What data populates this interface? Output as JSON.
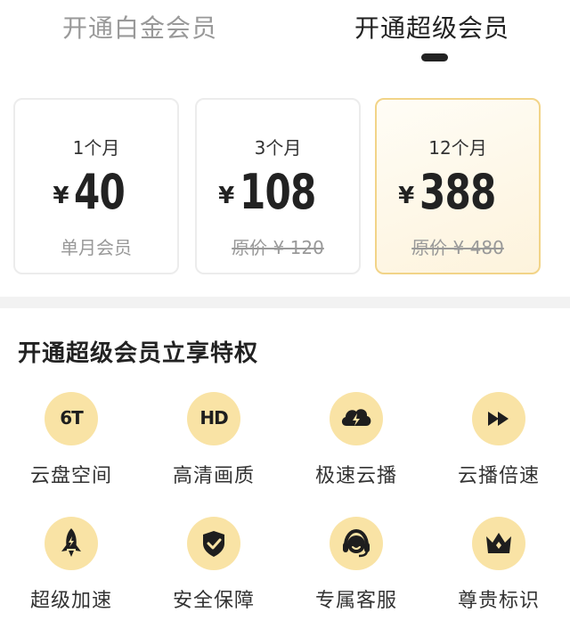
{
  "tabs": {
    "platinum": "开通白金会员",
    "super": "开通超级会员"
  },
  "plans": [
    {
      "duration": "1个月",
      "currency": "¥",
      "price": "40",
      "note": "单月会员"
    },
    {
      "duration": "3个月",
      "currency": "¥",
      "price": "108",
      "note": "原价 ¥ 120"
    },
    {
      "duration": "12个月",
      "currency": "¥",
      "price": "388",
      "note": "原价 ¥ 480"
    }
  ],
  "section": {
    "title": "开通超级会员立享特权"
  },
  "features": [
    {
      "label": "云盘空间",
      "badge": "6T",
      "icon": "storage-6t-icon"
    },
    {
      "label": "高清画质",
      "badge": "HD",
      "icon": "hd-icon"
    },
    {
      "label": "极速云播",
      "icon": "cloud-lightning-icon"
    },
    {
      "label": "云播倍速",
      "icon": "fast-forward-icon"
    },
    {
      "label": "超级加速",
      "icon": "rocket-icon"
    },
    {
      "label": "安全保障",
      "icon": "shield-check-icon"
    },
    {
      "label": "专属客服",
      "icon": "headset-icon"
    },
    {
      "label": "尊贵标识",
      "icon": "crown-icon"
    }
  ],
  "colors": {
    "accent_bg": "#f9e3a5",
    "selected_border": "#f2d488",
    "muted_text": "#999999"
  }
}
